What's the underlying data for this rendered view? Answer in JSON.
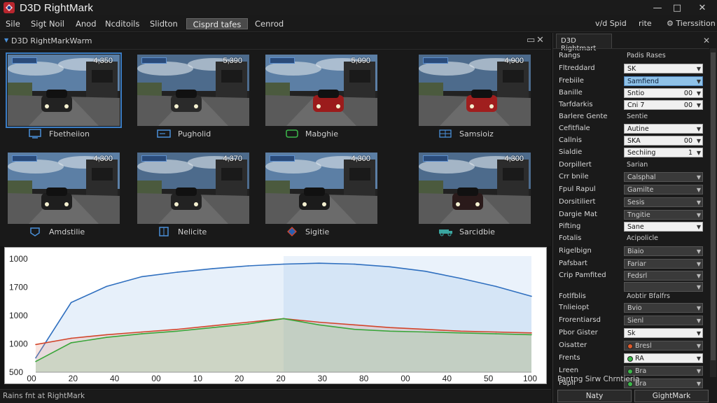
{
  "window": {
    "title": "D3D RightMark",
    "controls": [
      "—",
      "□",
      "✕"
    ]
  },
  "menubar": {
    "items": [
      "Sile",
      "Sigt Noil",
      "Anod",
      "Ncditoils",
      "Slidton",
      "Cisprd tafes",
      "Cenrod"
    ],
    "right": {
      "item1": "v/d Spid",
      "item2": "rite",
      "item3": "Tierssition"
    }
  },
  "panel": {
    "title": "D3D RightMarkWarm"
  },
  "thumbnails": [
    {
      "score": "4,350",
      "caption": "Fbetheiion"
    },
    {
      "score": "5,390",
      "caption": "Pugholid"
    },
    {
      "score": "5,090",
      "caption": "Mabghie"
    },
    {
      "score": "4,900",
      "caption": "Samsioiz"
    },
    {
      "score": "4,300",
      "caption": "Amdstilie"
    },
    {
      "score": "4,370",
      "caption": "Nelicite"
    },
    {
      "score": "4,300",
      "caption": "Sigitie"
    },
    {
      "score": "4,300",
      "caption": "Sarcidbie"
    }
  ],
  "chart_data": {
    "type": "line",
    "ytick_labels": [
      "1000",
      "1700",
      "1000",
      "1000",
      "500"
    ],
    "xtick_labels": [
      "00",
      "20",
      "40",
      "00",
      "10",
      "20",
      "20",
      "30",
      "80",
      "00",
      "40",
      "50",
      "100"
    ],
    "series": [
      {
        "color": "#2f6fbf",
        "values": [
          560,
          1180,
          1360,
          1470,
          1520,
          1560,
          1590,
          1610,
          1620,
          1610,
          1580,
          1530,
          1450,
          1360,
          1250
        ]
      },
      {
        "color": "#d2452b",
        "values": [
          710,
          780,
          820,
          850,
          880,
          920,
          960,
          1000,
          960,
          930,
          900,
          880,
          860,
          850,
          840
        ]
      },
      {
        "color": "#3aa63a",
        "values": [
          520,
          730,
          790,
          830,
          860,
          900,
          940,
          1000,
          930,
          880,
          860,
          850,
          840,
          830,
          820
        ]
      }
    ]
  },
  "status": {
    "text": "Rains fnt at RightMark"
  },
  "rightpanel": {
    "tab": "D3D Rightmart",
    "header": {
      "label": "Rangs",
      "value": "Padis Rases"
    },
    "rows": [
      {
        "label": "Fltreddard",
        "value": "SK",
        "num": "",
        "style": "light"
      },
      {
        "label": "Frebiile",
        "value": "Samfiend",
        "num": "",
        "style": "blue"
      },
      {
        "label": "Banille",
        "value": "Sntio",
        "num": "00",
        "style": "light"
      },
      {
        "label": "Tarfdarkis",
        "value": "Cni 7",
        "num": "00",
        "style": "light"
      },
      {
        "label": "Barlere Gente",
        "value": "Sentie",
        "num": "",
        "style": "plain"
      },
      {
        "label": "Cefitfiale",
        "value": "Autine",
        "num": "",
        "style": "light"
      },
      {
        "label": "Callnis",
        "value": "SKA",
        "num": "00",
        "style": "light"
      },
      {
        "label": "Sialdie",
        "value": "Sechiing",
        "num": "1",
        "style": "light"
      },
      {
        "label": "Dorpillert",
        "value": "Sarian",
        "num": "",
        "style": "plain"
      },
      {
        "label": "Crr bnile",
        "value": "Calsphal",
        "num": "",
        "style": "dark"
      },
      {
        "label": "Fpul Rapul",
        "value": "Gamilte",
        "num": "",
        "style": "dark"
      },
      {
        "label": "Dorsitiliert",
        "value": "Sesis",
        "num": "",
        "style": "dark"
      },
      {
        "label": "Dargie Mat",
        "value": "Tngitie",
        "num": "",
        "style": "dark"
      },
      {
        "label": "Pifting",
        "value": "Sane",
        "num": "",
        "style": "light"
      },
      {
        "label": "Fotalis",
        "value": "Acipolicle",
        "num": "",
        "style": "plain"
      },
      {
        "label": "Rigelbign",
        "value": "Biaio",
        "num": "",
        "style": "dark"
      },
      {
        "label": "Pafsbart",
        "value": "Fariar",
        "num": "",
        "style": "dark"
      },
      {
        "label": "Crip Pamfited",
        "value": "Fedsrl",
        "num": "",
        "style": "dark"
      },
      {
        "label": "",
        "value": "",
        "num": "",
        "style": "dark"
      },
      {
        "label": "Fotlfblis",
        "value": "Aobtir Bfalfrs",
        "num": "",
        "style": "plain"
      },
      {
        "label": "Tnlieiopt",
        "value": "Bvio",
        "num": "",
        "style": "dark"
      },
      {
        "label": "Frorentiarsd",
        "value": "Sienl",
        "num": "",
        "style": "dark"
      },
      {
        "label": "Pbor Gister",
        "value": "Sk",
        "num": "",
        "style": "light"
      },
      {
        "label": "Oisatter",
        "value": "Bresl",
        "num": "",
        "style": "dark",
        "dot": "#e05a2a"
      },
      {
        "label": "Frents",
        "value": "RA",
        "num": "",
        "style": "light",
        "dot": "#3cb84a"
      },
      {
        "label": "Lreen",
        "value": "Bra",
        "num": "",
        "style": "dark",
        "dot": "#3cb84a"
      },
      {
        "label": "Papir",
        "value": "Bra",
        "num": "",
        "style": "dark",
        "dot": "#3cb84a"
      }
    ],
    "footer": "Pantng Sirw Chrntieria",
    "buttons": [
      "Naty",
      "GightMark"
    ]
  }
}
